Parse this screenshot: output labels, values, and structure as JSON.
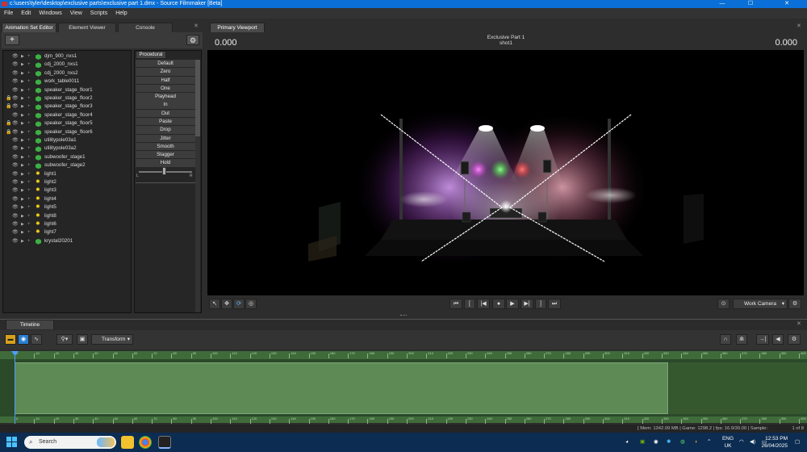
{
  "window": {
    "title": "c:\\users\\tyler\\desktop\\exclusive parts\\exclusive part 1.dmx - Source Filmmaker [Beta]",
    "minimize": "—",
    "maximize": "☐",
    "close": "✕"
  },
  "menu": [
    "File",
    "Edit",
    "Windows",
    "View",
    "Scripts",
    "Help"
  ],
  "left_panel": {
    "tabs": [
      "Animation Set Editor",
      "Element Viewer",
      "Console"
    ],
    "add_label": "+",
    "tree_items": [
      {
        "label": "djm_900_nxs1",
        "kind": "model",
        "locked": false
      },
      {
        "label": "cdj_2000_nxs1",
        "kind": "model",
        "locked": false
      },
      {
        "label": "cdj_2000_nxs2",
        "kind": "model",
        "locked": false
      },
      {
        "label": "work_table0011",
        "kind": "model",
        "locked": false
      },
      {
        "label": "speaker_stage_floor1",
        "kind": "model",
        "locked": false
      },
      {
        "label": "speaker_stage_floor2",
        "kind": "model",
        "locked": true
      },
      {
        "label": "speaker_stage_floor3",
        "kind": "model",
        "locked": true
      },
      {
        "label": "speaker_stage_floor4",
        "kind": "model",
        "locked": false
      },
      {
        "label": "speaker_stage_floor5",
        "kind": "model",
        "locked": true
      },
      {
        "label": "speaker_stage_floor6",
        "kind": "model",
        "locked": true
      },
      {
        "label": "utilitypole03a1",
        "kind": "model",
        "locked": false
      },
      {
        "label": "utilitypole03a2",
        "kind": "model",
        "locked": false
      },
      {
        "label": "subwoofer_stage1",
        "kind": "model",
        "locked": false
      },
      {
        "label": "subwoofer_stage2",
        "kind": "model",
        "locked": false
      },
      {
        "label": "light1",
        "kind": "light",
        "locked": false
      },
      {
        "label": "light2",
        "kind": "light",
        "locked": false
      },
      {
        "label": "light3",
        "kind": "light",
        "locked": false
      },
      {
        "label": "light4",
        "kind": "light",
        "locked": false
      },
      {
        "label": "light5",
        "kind": "light",
        "locked": false
      },
      {
        "label": "light8",
        "kind": "light",
        "locked": false
      },
      {
        "label": "light6",
        "kind": "light",
        "locked": false
      },
      {
        "label": "light7",
        "kind": "light",
        "locked": false
      },
      {
        "label": "krystal20201",
        "kind": "model",
        "locked": false
      }
    ],
    "procedural_tab": "Procedural",
    "procedural_buttons": [
      "Default",
      "Zero",
      "Half",
      "One",
      "Playhead",
      "In",
      "Out",
      "Paste",
      "Drop",
      "Jitter",
      "Smooth",
      "Stagger",
      "Hold"
    ],
    "slider_left": "L",
    "slider_right": "R"
  },
  "viewport": {
    "tab": "Primary Viewport",
    "time_left": "0.000",
    "time_right": "0.000",
    "title": "Exclusive Part 1",
    "shot": "shot1",
    "camera": "Work Camera"
  },
  "timeline": {
    "tab": "Timeline",
    "transform_label": "Transform",
    "ruler_labels": [
      "0",
      "10",
      "20",
      "30",
      "40",
      "50",
      "60",
      "70",
      "80",
      "90",
      "100",
      "110",
      "120",
      "130",
      "140",
      "150",
      "160",
      "170",
      "180",
      "190",
      "200",
      "210",
      "220",
      "230",
      "240",
      "250",
      "260",
      "270",
      "280",
      "290",
      "300",
      "310",
      "320",
      "330",
      "340",
      "350",
      "360",
      "370",
      "380",
      "390",
      "400"
    ]
  },
  "status": {
    "text": "[ Mem: 1342.09 MB | Game: 1298.2 | fps: 16.9/30.00 | Sample:",
    "pages": "1 of 8"
  },
  "taskbar": {
    "search_placeholder": "Search",
    "lang_top": "ENG",
    "lang_bottom": "UK",
    "time": "12:53 PM",
    "date": "26/04/2025"
  },
  "colors": {
    "titlebar": "#0a6fd6",
    "taskbar": "#0c2c52",
    "timeline_clip": "#5d8a55",
    "playhead": "#4aa0ff"
  }
}
